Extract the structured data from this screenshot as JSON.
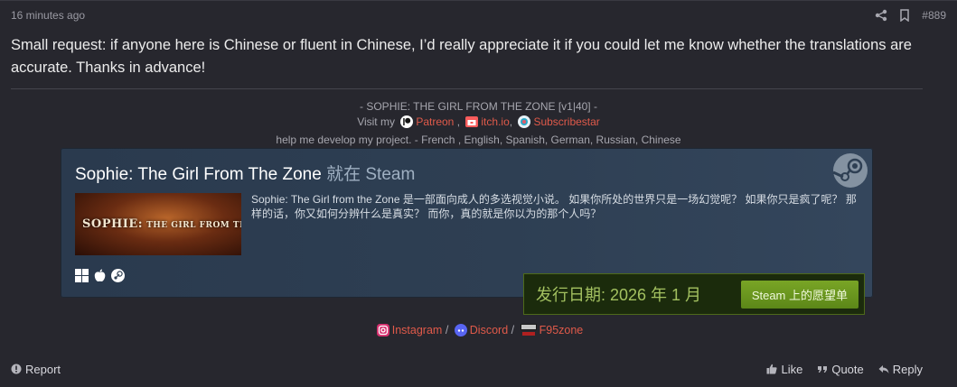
{
  "post": {
    "timestamp": "16 minutes ago",
    "number": "#889",
    "body": "Small request: if anyone here is Chinese or fluent in Chinese, I’d really appreciate it if you could let me know whether the translations are accurate. Thanks in advance!"
  },
  "signature": {
    "line1": "- SOPHIE: THE GIRL FROM THE ZONE [v1|40] -",
    "visit_prefix": "Visit my",
    "patreon": "Patreon",
    "sep1": ",",
    "itch": "itch.io",
    "sep2": ",",
    "subscribestar": "Subscribestar",
    "line3": "help me develop my project. - French , English, Spanish, German, Russian, Chinese"
  },
  "steam_widget": {
    "game_title": "Sophie: The Girl From The Zone",
    "title_suffix": "就在 Steam",
    "capsule_text_big": "SOPHIE:",
    "capsule_text_small": "THE GIRL FROM THE ZONE",
    "description": "Sophie: The Girl from the Zone 是一部面向成人的多选视觉小说。 如果你所处的世界只是一场幻觉呢？ 如果你只是疯了呢？ 那样的话，你又如何分辨什么是真实？ 而你，真的就是你以为的那个人吗？",
    "platforms": [
      "windows-icon",
      "apple-icon",
      "steam-icon"
    ],
    "release_label": "发行日期: 2026 年 1 月",
    "wishlist_button": "Steam 上的愿望单"
  },
  "links": {
    "instagram": "Instagram",
    "sep1": "/",
    "discord": "Discord",
    "sep2": "/",
    "f95zone": "F95zone"
  },
  "footer": {
    "report": "Report",
    "like": "Like",
    "quote": "Quote",
    "reply": "Reply"
  },
  "colors": {
    "background": "#27272e",
    "link": "#e05a4a",
    "steam_widget_bg": "#2e3f53",
    "wishlist_green": "#6b9a20"
  }
}
